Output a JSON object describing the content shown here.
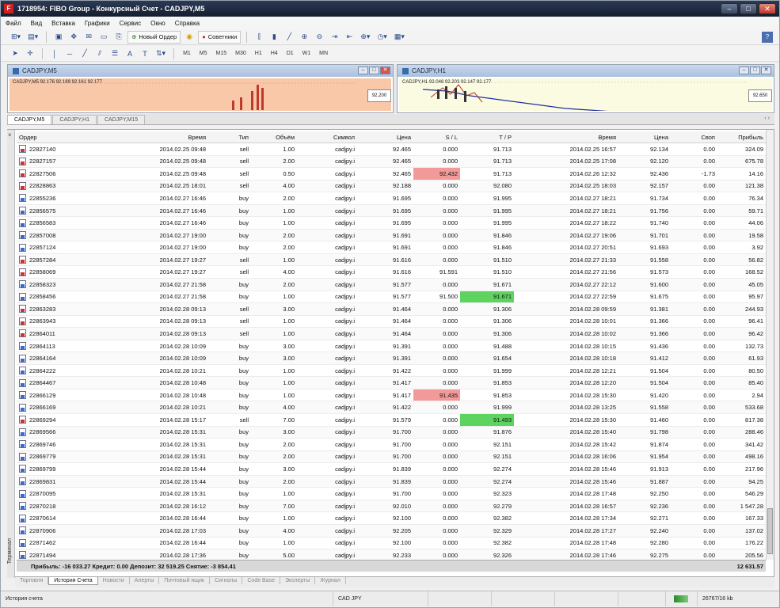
{
  "window": {
    "title": "1718954: FIBO Group - Конкурсный Счет - CADJPY,M5",
    "app_icon": "F"
  },
  "menu": [
    "Файл",
    "Вид",
    "Вставка",
    "Графики",
    "Сервис",
    "Окно",
    "Справка"
  ],
  "toolbar": {
    "new_order": "Новый Ордер",
    "advisors": "Советники",
    "timeframes": [
      "M1",
      "M5",
      "M15",
      "M30",
      "H1",
      "H4",
      "D1",
      "W1",
      "MN"
    ]
  },
  "charts": [
    {
      "title": "CADJPY,M5",
      "label": "CADJPY,M5 92.176 92.189 92.161 92.177",
      "price": "92.200"
    },
    {
      "title": "CADJPY,H1",
      "label": "CADJPY,H1 92.048 92.203 92.147 92.177",
      "price": "92.650"
    }
  ],
  "chart_tabs": [
    "CADJPY,M5",
    "CADJPY,H1",
    "CADJPY,M15"
  ],
  "columns": [
    "Ордер",
    "Время",
    "Тип",
    "Объём",
    "Символ",
    "Цена",
    "S / L",
    "T / P",
    "Время",
    "Цена",
    "Своп",
    "Прибыль"
  ],
  "rows": [
    [
      "22827140",
      "2014.02.25 09:48",
      "sell",
      "1.00",
      "cadjpy.i",
      "92.465",
      "0.000",
      "91.713",
      "2014.02.25 16:57",
      "92.134",
      "0.00",
      "324.09"
    ],
    [
      "22827157",
      "2014.02.25 09:48",
      "sell",
      "2.00",
      "cadjpy.i",
      "92.465",
      "0.000",
      "91.713",
      "2014.02.25 17:08",
      "92.120",
      "0.00",
      "675.78"
    ],
    [
      "22827506",
      "2014.02.25 09:48",
      "sell",
      "0.50",
      "cadjpy.i",
      "92.465",
      "92.432",
      "91.713",
      "2014.02.26 12:32",
      "92.436",
      "-1.73",
      "14.16"
    ],
    [
      "22828863",
      "2014.02.25 18:01",
      "sell",
      "4.00",
      "cadjpy.i",
      "92.188",
      "0.000",
      "92.080",
      "2014.02.25 18:03",
      "92.157",
      "0.00",
      "121.38"
    ],
    [
      "22855236",
      "2014.02.27 16:46",
      "buy",
      "2.00",
      "cadjpy.i",
      "91.695",
      "0.000",
      "91.995",
      "2014.02.27 18:21",
      "91.734",
      "0.00",
      "76.34"
    ],
    [
      "22856575",
      "2014.02.27 16:46",
      "buy",
      "1.00",
      "cadjpy.i",
      "91.695",
      "0.000",
      "91.995",
      "2014.02.27 18:21",
      "91.756",
      "0.00",
      "59.71"
    ],
    [
      "22856583",
      "2014.02.27 16:46",
      "buy",
      "1.00",
      "cadjpy.i",
      "91.695",
      "0.000",
      "91.995",
      "2014.02.27 18:22",
      "91.740",
      "0.00",
      "44.06"
    ],
    [
      "22857008",
      "2014.02.27 19:00",
      "buy",
      "2.00",
      "cadjpy.i",
      "91.691",
      "0.000",
      "91.846",
      "2014.02.27 19:06",
      "91.701",
      "0.00",
      "19.58"
    ],
    [
      "22857124",
      "2014.02.27 19:00",
      "buy",
      "2.00",
      "cadjpy.i",
      "91.691",
      "0.000",
      "91.846",
      "2014.02.27 20:51",
      "91.693",
      "0.00",
      "3.92"
    ],
    [
      "22857284",
      "2014.02.27 19:27",
      "sell",
      "1.00",
      "cadjpy.i",
      "91.616",
      "0.000",
      "91.510",
      "2014.02.27 21:33",
      "91.558",
      "0.00",
      "56.82"
    ],
    [
      "22858069",
      "2014.02.27 19:27",
      "sell",
      "4.00",
      "cadjpy.i",
      "91.616",
      "91.591",
      "91.510",
      "2014.02.27 21:56",
      "91.573",
      "0.00",
      "168.52"
    ],
    [
      "22858323",
      "2014.02.27 21:58",
      "buy",
      "2.00",
      "cadjpy.i",
      "91.577",
      "0.000",
      "91.671",
      "2014.02.27 22:12",
      "91.600",
      "0.00",
      "45.05"
    ],
    [
      "22858456",
      "2014.02.27 21:58",
      "buy",
      "1.00",
      "cadjpy.i",
      "91.577",
      "91.500",
      "91.671",
      "2014.02.27 22:59",
      "91.675",
      "0.00",
      "95.97"
    ],
    [
      "22863283",
      "2014.02.28 09:13",
      "sell",
      "3.00",
      "cadjpy.i",
      "91.464",
      "0.000",
      "91.306",
      "2014.02.28 09:59",
      "91.381",
      "0.00",
      "244.93"
    ],
    [
      "22863943",
      "2014.02.28 09:13",
      "sell",
      "1.00",
      "cadjpy.i",
      "91.464",
      "0.000",
      "91.306",
      "2014.02.28 10:01",
      "91.366",
      "0.00",
      "96.41"
    ],
    [
      "22864011",
      "2014.02.28 09:13",
      "sell",
      "1.00",
      "cadjpy.i",
      "91.464",
      "0.000",
      "91.306",
      "2014.02.28 10:02",
      "91.366",
      "0.00",
      "96.42"
    ],
    [
      "22864113",
      "2014.02.28 10:09",
      "buy",
      "3.00",
      "cadjpy.i",
      "91.391",
      "0.000",
      "91.488",
      "2014.02.28 10:15",
      "91.436",
      "0.00",
      "132.73"
    ],
    [
      "22864164",
      "2014.02.28 10:09",
      "buy",
      "3.00",
      "cadjpy.i",
      "91.391",
      "0.000",
      "91.654",
      "2014.02.28 10:18",
      "91.412",
      "0.00",
      "61.93"
    ],
    [
      "22864222",
      "2014.02.28 10:21",
      "buy",
      "1.00",
      "cadjpy.i",
      "91.422",
      "0.000",
      "91.999",
      "2014.02.28 12:21",
      "91.504",
      "0.00",
      "80.50"
    ],
    [
      "22864467",
      "2014.02.28 10:48",
      "buy",
      "1.00",
      "cadjpy.i",
      "91.417",
      "0.000",
      "91.853",
      "2014.02.28 12:20",
      "91.504",
      "0.00",
      "85.40"
    ],
    [
      "22866129",
      "2014.02.28 10:48",
      "buy",
      "1.00",
      "cadjpy.i",
      "91.417",
      "91.435",
      "91.853",
      "2014.02.28 15:30",
      "91.420",
      "0.00",
      "2.94"
    ],
    [
      "22866169",
      "2014.02.28 10:21",
      "buy",
      "4.00",
      "cadjpy.i",
      "91.422",
      "0.000",
      "91.999",
      "2014.02.28 13:25",
      "91.558",
      "0.00",
      "533.68"
    ],
    [
      "22869294",
      "2014.02.28 15:17",
      "sell",
      "7.00",
      "cadjpy.i",
      "91.579",
      "0.000",
      "91.493",
      "2014.02.28 15:30",
      "91.460",
      "0.00",
      "817.38"
    ],
    [
      "22869566",
      "2014.02.28 15:31",
      "buy",
      "3.00",
      "cadjpy.i",
      "91.700",
      "0.000",
      "91.876",
      "2014.02.28 15:40",
      "91.798",
      "0.00",
      "288.46"
    ],
    [
      "22869746",
      "2014.02.28 15:31",
      "buy",
      "2.00",
      "cadjpy.i",
      "91.700",
      "0.000",
      "92.151",
      "2014.02.28 15:42",
      "91.874",
      "0.00",
      "341.42"
    ],
    [
      "22869779",
      "2014.02.28 15:31",
      "buy",
      "2.00",
      "cadjpy.i",
      "91.700",
      "0.000",
      "92.151",
      "2014.02.28 16:06",
      "91.954",
      "0.00",
      "498.16"
    ],
    [
      "22869799",
      "2014.02.28 15:44",
      "buy",
      "3.00",
      "cadjpy.i",
      "91.839",
      "0.000",
      "92.274",
      "2014.02.28 15:46",
      "91.913",
      "0.00",
      "217.96"
    ],
    [
      "22869831",
      "2014.02.28 15:44",
      "buy",
      "2.00",
      "cadjpy.i",
      "91.839",
      "0.000",
      "92.274",
      "2014.02.28 15:46",
      "91.887",
      "0.00",
      "94.25"
    ],
    [
      "22870095",
      "2014.02.28 15:31",
      "buy",
      "1.00",
      "cadjpy.i",
      "91.700",
      "0.000",
      "92.323",
      "2014.02.28 17:48",
      "92.250",
      "0.00",
      "546.29"
    ],
    [
      "22870218",
      "2014.02.28 16:12",
      "buy",
      "7.00",
      "cadjpy.i",
      "92.010",
      "0.000",
      "92.279",
      "2014.02.28 16:57",
      "92.236",
      "0.00",
      "1 547.28"
    ],
    [
      "22870614",
      "2014.02.28 16:44",
      "buy",
      "1.00",
      "cadjpy.i",
      "92.100",
      "0.000",
      "92.382",
      "2014.02.28 17:34",
      "92.271",
      "0.00",
      "167.33"
    ],
    [
      "22870906",
      "2014.02.28 17:03",
      "buy",
      "4.00",
      "cadjpy.i",
      "92.205",
      "0.000",
      "92.329",
      "2014.02.28 17:27",
      "92.240",
      "0.00",
      "137.02"
    ],
    [
      "22871462",
      "2014.02.28 16:44",
      "buy",
      "1.00",
      "cadjpy.i",
      "92.100",
      "0.000",
      "92.382",
      "2014.02.28 17:48",
      "92.280",
      "0.00",
      "176.22"
    ],
    [
      "22871494",
      "2014.02.28 17:36",
      "buy",
      "5.00",
      "cadjpy.i",
      "92.233",
      "0.000",
      "92.326",
      "2014.02.28 17:46",
      "92.275",
      "0.00",
      "205.56"
    ]
  ],
  "highlights": {
    "2": {
      "6": "red"
    },
    "12": {
      "7": "green"
    },
    "20": {
      "6": "red"
    },
    "22": {
      "7": "green"
    }
  },
  "totals": {
    "summary": "Прибыль: -16 033.27  Кредит: 0.00  Депозит: 32 519.25  Снятие: -3 854.41",
    "profit": "12 631.57"
  },
  "terminal_label": "Терминал",
  "bottom_tabs": [
    "Торговля",
    "История Счета",
    "Новости",
    "Алерты",
    "Почтовый ящик",
    "Сигналы",
    "Code Base",
    "Эксперты",
    "Журнал"
  ],
  "status": {
    "left": "История счета",
    "symbol": "CAD JPY",
    "traffic": "26767/16 kb"
  }
}
